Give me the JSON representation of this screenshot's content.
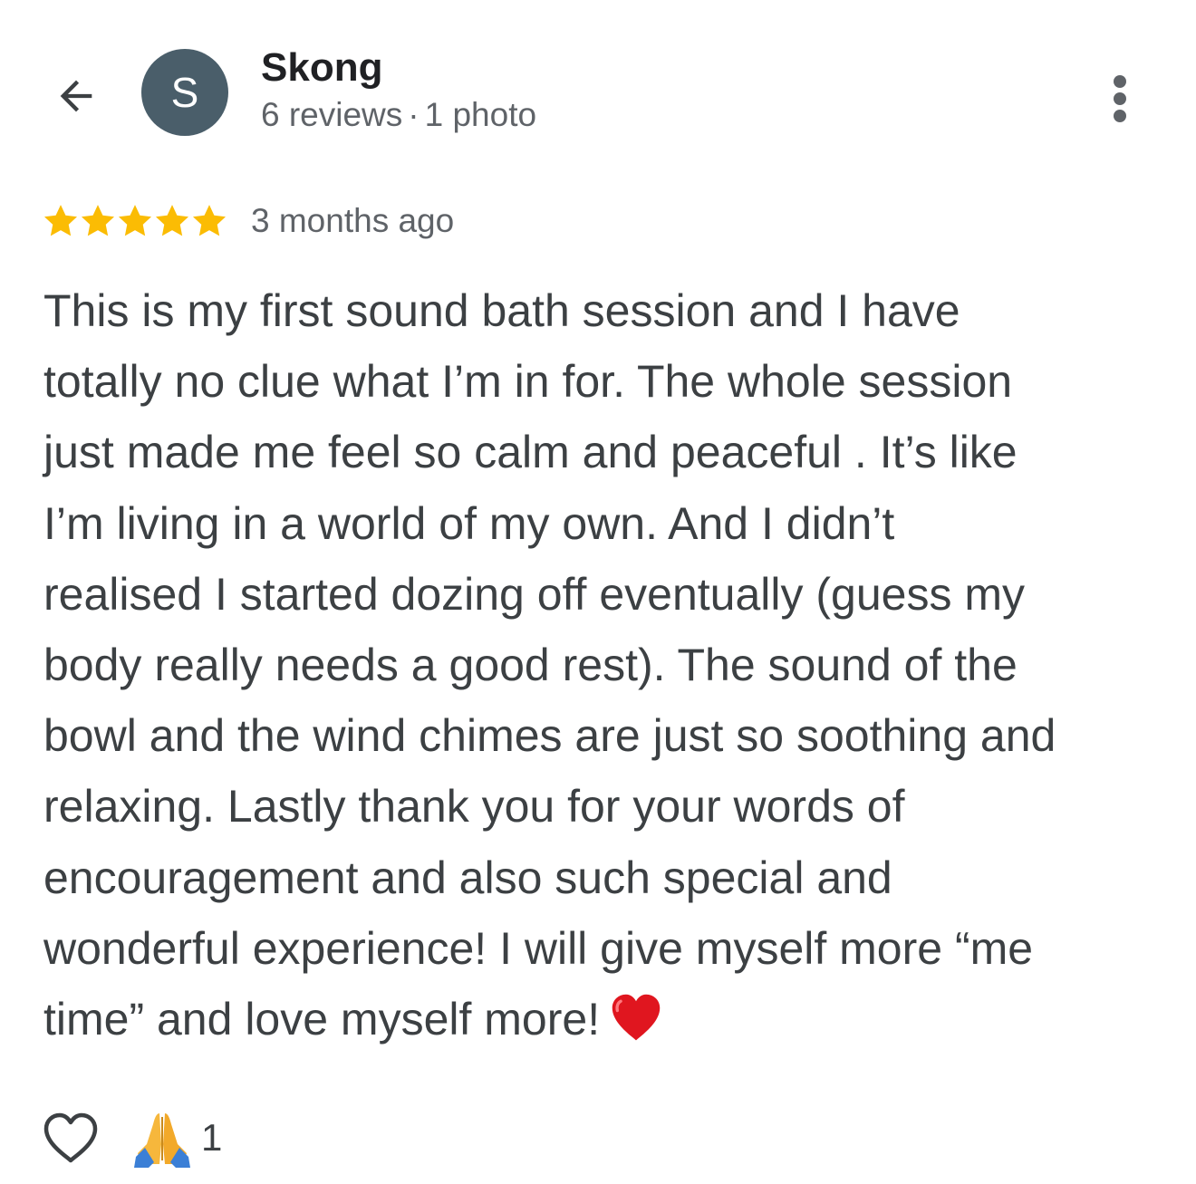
{
  "header": {
    "back_icon": "arrow-back-icon",
    "avatar_letter": "S",
    "avatar_color": "#4a5e6a",
    "name": "Skong",
    "reviews_count": "6 reviews",
    "separator": "·",
    "photos_count": "1 photo",
    "more_icon": "more-vert-icon"
  },
  "review": {
    "rating": 5,
    "rating_max": 5,
    "star_color": "#fbbc04",
    "time_ago": "3 months ago",
    "text": "This is my first sound bath session and I have\ntotally no clue what I’m in for. The whole session\njust made me feel so calm and peaceful . It’s like\nI’m living in a world of my own. And I didn’t\nrealised I started dozing off eventually (guess my\nbody really needs a good rest). The sound of the\nbowl and the wind chimes are just so soothing and\nrelaxing. Lastly thank you for your words of\nencouragement and also such special and\nwonderful experience! I will give myself more “me\ntime” and love myself more!",
    "trailing_emoji": "red-heart-emoji"
  },
  "reactions": {
    "like_icon": "heart-outline-icon",
    "reaction_emoji": "folded-hands-emoji",
    "reaction_count": "1"
  }
}
